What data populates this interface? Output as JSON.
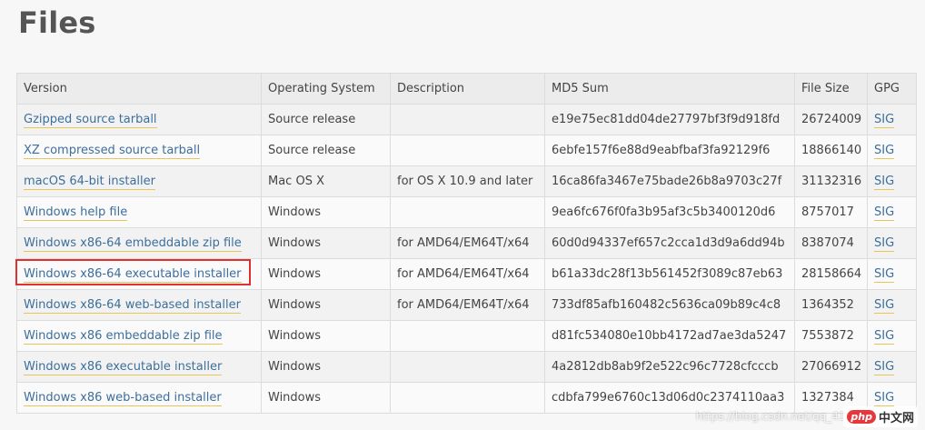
{
  "page": {
    "title": "Files"
  },
  "table": {
    "columns": [
      "Version",
      "Operating System",
      "Description",
      "MD5 Sum",
      "File Size",
      "GPG"
    ],
    "rows": [
      {
        "version": "Gzipped source tarball",
        "os": "Source release",
        "description": "",
        "md5": "e19e75ec81dd04de27797bf3f9d918fd",
        "size": "26724009",
        "gpg": "SIG"
      },
      {
        "version": "XZ compressed source tarball",
        "os": "Source release",
        "description": "",
        "md5": "6ebfe157f6e88d9eabfbaf3fa92129f6",
        "size": "18866140",
        "gpg": "SIG"
      },
      {
        "version": "macOS 64-bit installer",
        "os": "Mac OS X",
        "description": "for OS X 10.9 and later",
        "md5": "16ca86fa3467e75bade26b8a9703c27f",
        "size": "31132316",
        "gpg": "SIG"
      },
      {
        "version": "Windows help file",
        "os": "Windows",
        "description": "",
        "md5": "9ea6fc676f0fa3b95af3c5b3400120d6",
        "size": "8757017",
        "gpg": "SIG"
      },
      {
        "version": "Windows x86-64 embeddable zip file",
        "os": "Windows",
        "description": "for AMD64/EM64T/x64",
        "md5": "60d0d94337ef657c2cca1d3d9a6dd94b",
        "size": "8387074",
        "gpg": "SIG"
      },
      {
        "version": "Windows x86-64 executable installer",
        "os": "Windows",
        "description": "for AMD64/EM64T/x64",
        "md5": "b61a33dc28f13b561452f3089c87eb63",
        "size": "28158664",
        "gpg": "SIG"
      },
      {
        "version": "Windows x86-64 web-based installer",
        "os": "Windows",
        "description": "for AMD64/EM64T/x64",
        "md5": "733df85afb160482c5636ca09b89c4c8",
        "size": "1364352",
        "gpg": "SIG"
      },
      {
        "version": "Windows x86 embeddable zip file",
        "os": "Windows",
        "description": "",
        "md5": "d81fc534080e10bb4172ad7ae3da5247",
        "size": "7553872",
        "gpg": "SIG"
      },
      {
        "version": "Windows x86 executable installer",
        "os": "Windows",
        "description": "",
        "md5": "4a2812db8ab9f2e522c96c7728cfcccb",
        "size": "27066912",
        "gpg": "SIG"
      },
      {
        "version": "Windows x86 web-based installer",
        "os": "Windows",
        "description": "",
        "md5": "cdbfa799e6760c13d06d0c2374110aa3",
        "size": "1327384",
        "gpg": "SIG"
      }
    ]
  },
  "watermark": {
    "text": "https://blog.csdn.net/qq_41..."
  },
  "logo": {
    "mark": "php",
    "text": "中文网"
  },
  "colors": {
    "link": "#3c6f9c",
    "link_underline": "#e6c65a",
    "highlight": "#e03131"
  }
}
